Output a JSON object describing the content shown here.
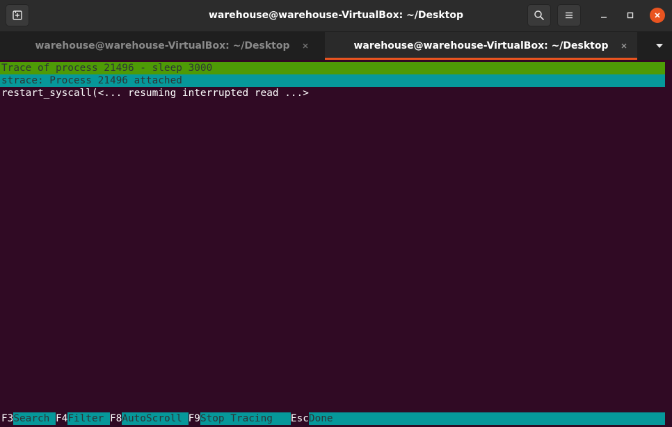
{
  "window": {
    "title": "warehouse@warehouse-VirtualBox: ~/Desktop"
  },
  "headerbar": {
    "new_tab_icon": "new-tab-icon",
    "search_icon": "search-icon",
    "menu_icon": "hamburger-menu-icon",
    "minimize_icon": "minimize-icon",
    "maximize_icon": "maximize-icon",
    "close_icon": "close-icon"
  },
  "tabs": [
    {
      "label": "warehouse@warehouse-VirtualBox: ~/Desktop",
      "active": false
    },
    {
      "label": "warehouse@warehouse-VirtualBox: ~/Desktop",
      "active": true
    }
  ],
  "terminal": {
    "lines": [
      "Trace of process 21496 - sleep 3000",
      "strace: Process 21496 attached",
      "restart_syscall(<... resuming interrupted read ...>"
    ],
    "fkeys": [
      {
        "key": "F3",
        "label": "Search "
      },
      {
        "key": "F4",
        "label": "Filter "
      },
      {
        "key": "F8",
        "label": "AutoScroll "
      },
      {
        "key": "F9",
        "label": "Stop Tracing   "
      },
      {
        "key": "Esc",
        "label": "Done"
      }
    ]
  },
  "colors": {
    "terminal_bg": "#300a24",
    "accent": "#e95420",
    "trace_highlight": "#4e9a06",
    "info_highlight": "#06989a"
  }
}
